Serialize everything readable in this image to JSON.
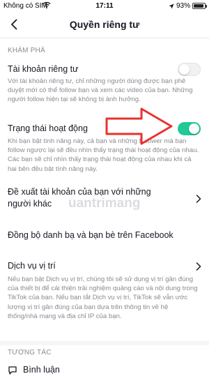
{
  "status": {
    "carrier": "Không có SIM",
    "time": "17:11",
    "battery": "93%",
    "battery_level": 0.93
  },
  "nav": {
    "title": "Quyền riêng tư"
  },
  "discover": {
    "header": "KHÁM PHÁ",
    "private_account": {
      "title": "Tài khoản riêng tư",
      "desc": "Với tài khoản riêng tư, chỉ những người dùng được bạn phê duyệt mới có thể follow bạn và xem các video của bạn. Những người follow hiện tại sẽ không bị ảnh hưởng.",
      "enabled": false
    },
    "activity_status": {
      "title": "Trạng thái hoạt động",
      "desc": "Khi bạn bật tính năng này, cả bạn và những follower mà bạn follow ngược lại sẽ đều nhìn thấy trạng thái hoạt động của nhau. Các bạn sẽ chỉ nhìn thấy trạng thái hoạt động của nhau khi cả hai bên đều bật tính năng này.",
      "enabled": true
    },
    "suggest_account": {
      "title": "Đề xuất tài khoản của bạn với những người khác"
    },
    "sync_contacts": {
      "title": "Đồng bộ danh bạ và bạn bè trên Facebook"
    },
    "location": {
      "title": "Dịch vụ vị trí",
      "desc": "Nếu bạn bật Dịch vụ vị trí, chúng tôi sẽ sử dụng vị trí gần đúng của thiết bị để cải thiện trải nghiệm quảng cáo và nội dung trong TikTok của bạn. Nếu bạn tắt Dịch vụ vị trí, TikTok sẽ vẫn ước lượng vị trí gần đúng của bạn dựa trên thông tin về hệ thống/nhà mạng và địa chỉ IP của bạn."
    }
  },
  "interaction": {
    "header": "TƯƠNG TÁC",
    "comments": {
      "title": "Bình luận"
    }
  },
  "watermark": "uantrimang",
  "colors": {
    "toggle_on": "#20c997",
    "arrow": "#e8322f",
    "secondary_text": "#8a8b91"
  }
}
